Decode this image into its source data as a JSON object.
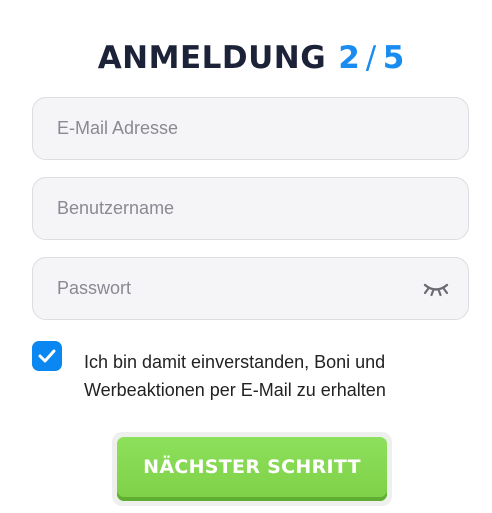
{
  "header": {
    "title": "ANMELDUNG",
    "step_current": "2",
    "step_separator": "/",
    "step_total": "5"
  },
  "form": {
    "email_placeholder": "E-Mail Adresse",
    "username_placeholder": "Benutzername",
    "password_placeholder": "Passwort",
    "password_toggle_icon": "eye-closed-icon",
    "consent": {
      "checked": true,
      "label": "Ich bin damit einverstanden, Boni und Werbeaktionen per E-Mail zu erhalten"
    },
    "submit_label": "NÄCHSTER SCHRITT"
  },
  "colors": {
    "accent_blue": "#1a8cf0",
    "title_dark": "#1c2237",
    "button_green": "#7ed047",
    "field_bg": "#f5f5f7"
  }
}
